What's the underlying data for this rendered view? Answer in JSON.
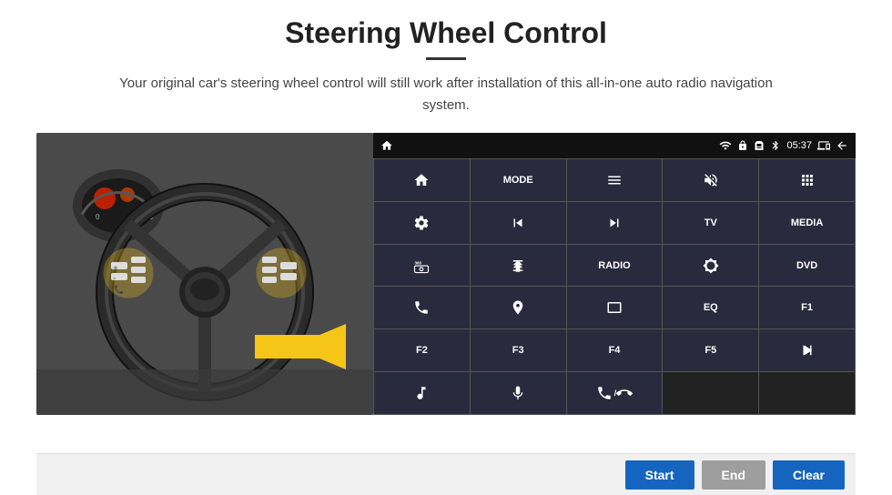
{
  "page": {
    "title": "Steering Wheel Control",
    "subtitle": "Your original car's steering wheel control will still work after installation of this all-in-one auto radio navigation system."
  },
  "statusBar": {
    "time": "05:37",
    "icons": [
      "wifi",
      "lock",
      "sim",
      "bluetooth",
      "screen",
      "back"
    ]
  },
  "buttons": [
    {
      "id": "home",
      "type": "icon",
      "icon": "home"
    },
    {
      "id": "mode",
      "type": "text",
      "label": "MODE"
    },
    {
      "id": "list",
      "type": "icon",
      "icon": "list"
    },
    {
      "id": "mute",
      "type": "icon",
      "icon": "mute"
    },
    {
      "id": "apps",
      "type": "icon",
      "icon": "apps"
    },
    {
      "id": "settings",
      "type": "icon",
      "icon": "settings"
    },
    {
      "id": "prev",
      "type": "icon",
      "icon": "prev"
    },
    {
      "id": "next",
      "type": "icon",
      "icon": "next"
    },
    {
      "id": "tv",
      "type": "text",
      "label": "TV"
    },
    {
      "id": "media",
      "type": "text",
      "label": "MEDIA"
    },
    {
      "id": "cam360",
      "type": "icon",
      "icon": "cam360"
    },
    {
      "id": "eject",
      "type": "icon",
      "icon": "eject"
    },
    {
      "id": "radio",
      "type": "text",
      "label": "RADIO"
    },
    {
      "id": "brightness",
      "type": "icon",
      "icon": "brightness"
    },
    {
      "id": "dvd",
      "type": "text",
      "label": "DVD"
    },
    {
      "id": "phone",
      "type": "icon",
      "icon": "phone"
    },
    {
      "id": "nav",
      "type": "icon",
      "icon": "nav"
    },
    {
      "id": "screen",
      "type": "icon",
      "icon": "screen"
    },
    {
      "id": "eq",
      "type": "text",
      "label": "EQ"
    },
    {
      "id": "f1",
      "type": "text",
      "label": "F1"
    },
    {
      "id": "f2",
      "type": "text",
      "label": "F2"
    },
    {
      "id": "f3",
      "type": "text",
      "label": "F3"
    },
    {
      "id": "f4",
      "type": "text",
      "label": "F4"
    },
    {
      "id": "f5",
      "type": "text",
      "label": "F5"
    },
    {
      "id": "playpause",
      "type": "icon",
      "icon": "playpause"
    },
    {
      "id": "music",
      "type": "icon",
      "icon": "music"
    },
    {
      "id": "mic",
      "type": "icon",
      "icon": "mic"
    },
    {
      "id": "call",
      "type": "icon",
      "icon": "call"
    },
    {
      "id": "empty1",
      "type": "empty",
      "label": ""
    },
    {
      "id": "empty2",
      "type": "empty",
      "label": ""
    }
  ],
  "bottomBar": {
    "startLabel": "Start",
    "endLabel": "End",
    "clearLabel": "Clear"
  }
}
